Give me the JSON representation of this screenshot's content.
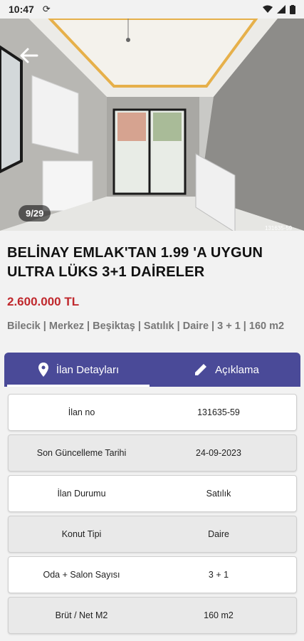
{
  "status": {
    "time": "10:47"
  },
  "hero": {
    "counter": "9/29",
    "ref": "131635-59",
    "logo_text": "BELİNAY EMLAK"
  },
  "listing": {
    "title": "BELİNAY EMLAK'TAN 1.99 'A UYGUN ULTRA LÜKS 3+1 DAİRELER",
    "price": "2.600.000 TL",
    "tags": "Bilecik | Merkez | Beşiktaş | Satılık | Daire | 3 + 1 | 160 m2"
  },
  "tabs": [
    {
      "label": "İlan Detayları",
      "icon": "location-pin-icon",
      "active": true
    },
    {
      "label": "Açıklama",
      "icon": "pencil-icon",
      "active": false
    }
  ],
  "details": [
    {
      "label": "İlan no",
      "value": "131635-59"
    },
    {
      "label": "Son Güncelleme Tarihi",
      "value": "24-09-2023"
    },
    {
      "label": "İlan Durumu",
      "value": "Satılık"
    },
    {
      "label": "Konut Tipi",
      "value": "Daire"
    },
    {
      "label": "Oda + Salon Sayısı",
      "value": "3 + 1"
    },
    {
      "label": "Brüt / Net M2",
      "value": "160 m2"
    }
  ],
  "colors": {
    "accent": "#4a4a98",
    "price": "#c0282d"
  }
}
